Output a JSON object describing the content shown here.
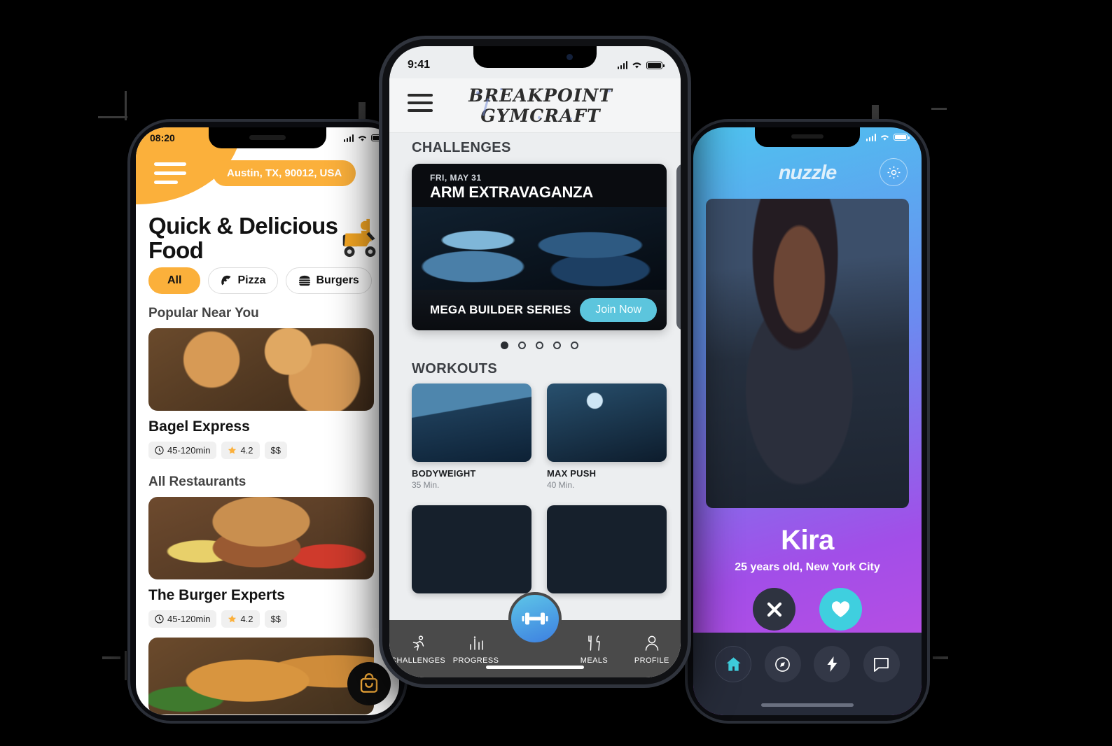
{
  "left_phone": {
    "status_bar": {
      "time": "08:20"
    },
    "location_pill": "Austin, TX, 90012, USA",
    "hero_title": "Quick & Delicious Food",
    "chips": [
      {
        "label": "All",
        "icon": "",
        "active": true
      },
      {
        "label": "Pizza",
        "icon": "pizza-icon",
        "active": false
      },
      {
        "label": "Burgers",
        "icon": "burger-icon",
        "active": false
      },
      {
        "label": "",
        "icon": "coffee-icon",
        "active": false
      }
    ],
    "sections": [
      {
        "heading": "Popular Near You"
      },
      {
        "heading": "All Restaurants"
      }
    ],
    "restaurants": [
      {
        "name": "Bagel Express",
        "time": "45-120min",
        "rating": "4.2",
        "price": "$$"
      },
      {
        "name": "The Burger Experts",
        "time": "45-120min",
        "rating": "4.2",
        "price": "$$"
      }
    ],
    "fab_icon": "shopping-bag-icon",
    "accent_color": "#FBB03B"
  },
  "mid_phone": {
    "status_bar": {
      "time": "9:41"
    },
    "app_title": "BREAKPOINT GYMCRAFT",
    "menu_icon": "hamburger-icon",
    "challenges": {
      "heading": "CHALLENGES",
      "card": {
        "date": "FRI, MAY 31",
        "title": "ARM EXTRAVAGANZA",
        "series": "MEGA BUILDER SERIES",
        "cta": "Join Now"
      },
      "dots_total": 5,
      "dots_active": 1
    },
    "workouts": {
      "heading": "WORKOUTS",
      "items": [
        {
          "name": "BODYWEIGHT",
          "duration": "35 Min."
        },
        {
          "name": "MAX PUSH",
          "duration": "40 Min."
        },
        {
          "name": "",
          "duration": ""
        },
        {
          "name": "",
          "duration": ""
        }
      ]
    },
    "tabs": [
      {
        "label": "CHALLENGES",
        "icon": "runner-icon"
      },
      {
        "label": "PROGRESS",
        "icon": "bar-chart-icon"
      },
      {
        "label": "MEALS",
        "icon": "cutlery-icon"
      },
      {
        "label": "PROFILE",
        "icon": "person-icon"
      }
    ],
    "center_action_icon": "dumbbell-icon",
    "accent_color": "#5cc5dd"
  },
  "right_phone": {
    "app_title": "nuzzle",
    "settings_icon": "gear-icon",
    "profile": {
      "name": "Kira",
      "subtitle": "25 years old, New York City"
    },
    "actions": [
      {
        "name": "nope",
        "icon": "close-icon"
      },
      {
        "name": "like",
        "icon": "heart-icon"
      }
    ],
    "nav": [
      {
        "icon": "home-icon",
        "selected": true
      },
      {
        "icon": "compass-icon",
        "selected": false
      },
      {
        "icon": "bolt-icon",
        "selected": false
      },
      {
        "icon": "chat-icon",
        "selected": false
      }
    ],
    "accent_color": "#3fcfdf"
  }
}
